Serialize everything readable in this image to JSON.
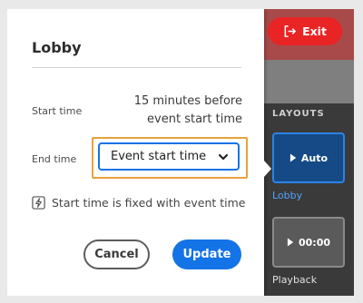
{
  "dialog": {
    "title": "Lobby",
    "start_time_label": "Start time",
    "start_time_value": "15 minutes before event start time",
    "end_time_label": "End time",
    "end_time_select": "Event start time",
    "note": "Start time is fixed with event time",
    "cancel_label": "Cancel",
    "update_label": "Update"
  },
  "panel": {
    "exit_label": "Exit",
    "layouts_heading": "LAYOUTS",
    "tiles": [
      {
        "text": "Auto",
        "label": "Lobby"
      },
      {
        "text": "00:00",
        "label": "Playback"
      }
    ]
  },
  "colors": {
    "accent": "#1473e6",
    "highlight": "#e8a23a",
    "exit": "#e92424",
    "panel_bg": "#3a3a3a"
  },
  "icons": [
    "chevron-down-icon",
    "lightning-icon",
    "exit-icon",
    "play-icon"
  ]
}
